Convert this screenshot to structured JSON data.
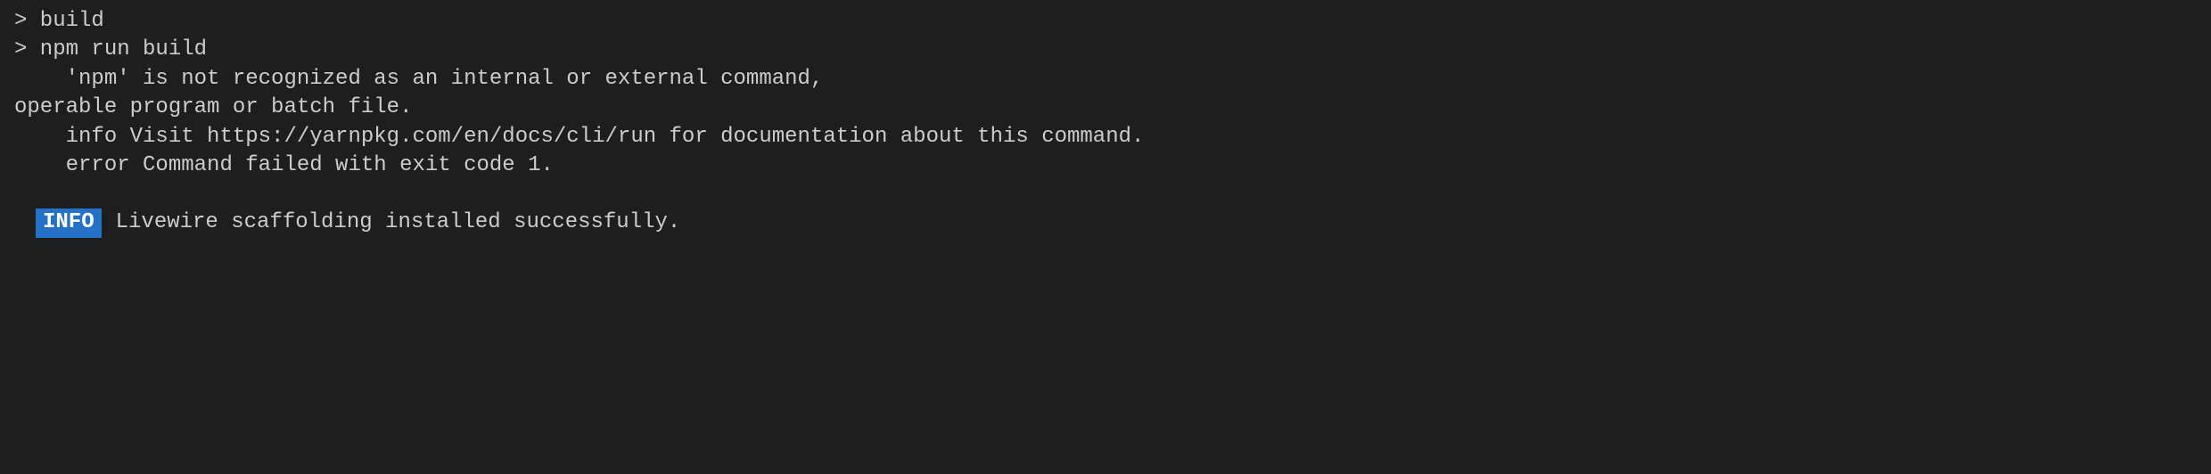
{
  "terminal": {
    "lines": [
      "> build",
      "> npm run build",
      "",
      "    'npm' is not recognized as an internal or external command,",
      "operable program or batch file.",
      "    info Visit https://yarnpkg.com/en/docs/cli/run for documentation about this command.",
      "    error Command failed with exit code 1."
    ],
    "info_badge": "INFO",
    "info_message": "Livewire scaffolding installed successfully."
  }
}
